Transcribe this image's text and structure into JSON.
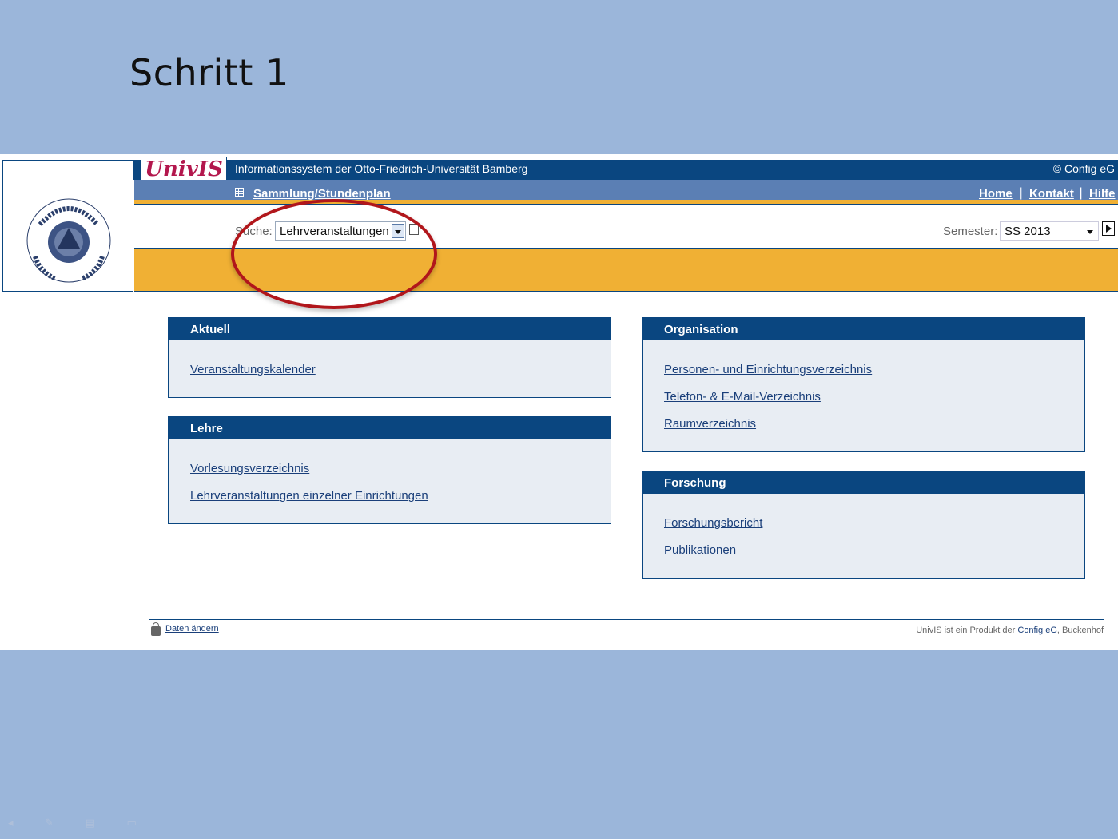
{
  "slide": {
    "title": "Schritt 1"
  },
  "header": {
    "logo_text": "UnivIS",
    "title": "Informationssystem der Otto-Friedrich-Universität Bamberg",
    "copyright": "© Config eG",
    "university_seal_text": "OTTO-FRIEDRICH-UNIVERSITÄT BAMBERG"
  },
  "nav": {
    "breadcrumb": "Sammlung/Stundenplan",
    "links": [
      "Home",
      "Kontakt",
      "Hilfe"
    ]
  },
  "search": {
    "label": "Suche:",
    "value": "Lehrveranstaltungen"
  },
  "semester": {
    "label": "Semester:",
    "value": "SS 2013"
  },
  "panels": {
    "aktuell": {
      "title": "Aktuell",
      "links": [
        "Veranstaltungskalender"
      ]
    },
    "lehre": {
      "title": "Lehre",
      "links": [
        "Vorlesungsverzeichnis",
        "Lehrveranstaltungen einzelner Einrichtungen"
      ]
    },
    "organisation": {
      "title": "Organisation",
      "links": [
        "Personen- und Einrichtungsverzeichnis",
        "Telefon- & E-Mail-Verzeichnis",
        "Raumverzeichnis"
      ]
    },
    "forschung": {
      "title": "Forschung",
      "links": [
        "Forschungsbericht",
        "Publikationen"
      ]
    }
  },
  "footer": {
    "left_link": "Daten ändern",
    "right_prefix": "UnivIS ist ein Produkt der ",
    "right_link": "Config eG",
    "right_suffix": ", Buckenhof"
  },
  "colors": {
    "slide_bg": "#9bb6da",
    "header_blue": "#0a4680",
    "nav_blue": "#5b7fb4",
    "accent_orange": "#f0b034",
    "highlight_red": "#b1161b",
    "brand_magenta": "#b3174d"
  }
}
